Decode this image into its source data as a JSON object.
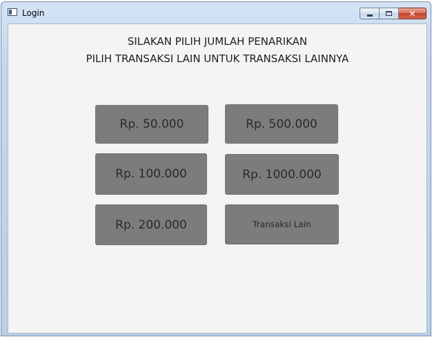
{
  "window": {
    "title": "Login",
    "controls": {
      "minimize_icon": "minimize-icon",
      "maximize_icon": "maximize-icon",
      "close_icon": "close-icon",
      "close_glyph": "✕"
    }
  },
  "content": {
    "heading_line1": "SILAKAN PILIH JUMLAH PENARIKAN",
    "heading_line2": "PILIH TRANSAKSI LAIN UNTUK TRANSAKSI LAINNYA"
  },
  "buttons": {
    "rp_50000": "Rp. 50.000",
    "rp_500000": "Rp. 500.000",
    "rp_100000": "Rp. 100.000",
    "rp_1000000": "Rp. 1000.000",
    "rp_200000": "Rp. 200.000",
    "other_transaction": "Transaksi Lain"
  },
  "colors": {
    "client_background": "#f4f4f4",
    "button_background": "#7c7c7c",
    "button_text": "#2a2a2a",
    "close_button": "#c4422b"
  }
}
